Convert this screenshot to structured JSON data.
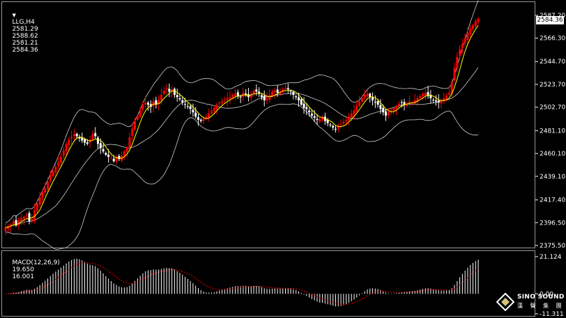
{
  "header": {
    "symbol": "LLG,H4",
    "open": "2581.29",
    "high": "2588.62",
    "low": "2581.21",
    "close": "2584.36"
  },
  "macd_header": {
    "label": "MACD(12,26,9)",
    "main": "19.650",
    "signal": "16.001"
  },
  "price_axis": {
    "ticks": [
      "2587.20",
      "2566.30",
      "2544.70",
      "2523.70",
      "2502.70",
      "2481.10",
      "2460.10",
      "2439.10",
      "2417.40",
      "2396.50",
      "2375.50"
    ],
    "last_price": "2584.36"
  },
  "macd_axis": {
    "ticks": [
      "21.124",
      "0.00",
      "-11.311"
    ]
  },
  "logo": {
    "brand": "SINO SOUND",
    "sub": "漢 聲 集 團"
  },
  "colors": {
    "background": "#000000",
    "bull_candle": "#ffffff",
    "bear_candle": "#ff0000",
    "bands": "#ffffff",
    "ma_line": "#ffff00",
    "macd_hist": "#ffffff",
    "macd_signal": "#ff0000"
  },
  "chart_data": {
    "type": "candlestick",
    "timeframe": "H4",
    "ylim": [
      2375.5,
      2587.2
    ],
    "close_series": [
      2392,
      2393,
      2395,
      2398,
      2394,
      2399,
      2401,
      2402,
      2404,
      2398,
      2400,
      2408,
      2414,
      2420,
      2425,
      2428,
      2434,
      2440,
      2444,
      2448,
      2452,
      2457,
      2463,
      2469,
      2473,
      2475,
      2478,
      2476,
      2474,
      2472,
      2470,
      2469,
      2473,
      2478,
      2476,
      2469,
      2465,
      2462,
      2459,
      2457,
      2456,
      2453,
      2457,
      2455,
      2458,
      2462,
      2466,
      2475,
      2483,
      2490,
      2495,
      2500,
      2505,
      2507,
      2505,
      2503,
      2508,
      2505,
      2509,
      2514,
      2518,
      2520,
      2517,
      2519,
      2514,
      2512,
      2510,
      2507,
      2505,
      2503,
      2501,
      2498,
      2494,
      2491,
      2490,
      2492,
      2494,
      2497,
      2499,
      2502,
      2505,
      2507,
      2508,
      2509,
      2511,
      2512,
      2514,
      2515,
      2513,
      2512,
      2516,
      2514,
      2512,
      2515,
      2518,
      2517,
      2515,
      2512,
      2509,
      2511,
      2514,
      2517,
      2518,
      2516,
      2517,
      2519,
      2520,
      2519,
      2517,
      2514,
      2512,
      2509,
      2505,
      2502,
      2501,
      2498,
      2495,
      2493,
      2491,
      2492,
      2494,
      2490,
      2488,
      2486,
      2484,
      2482,
      2485,
      2487,
      2489,
      2491,
      2494,
      2497,
      2500,
      2504,
      2508,
      2511,
      2514,
      2515,
      2512,
      2509,
      2507,
      2505,
      2501,
      2498,
      2495,
      2498,
      2500,
      2502,
      2504,
      2506,
      2507,
      2505,
      2506,
      2508,
      2507,
      2509,
      2511,
      2513,
      2515,
      2516,
      2513,
      2511,
      2509,
      2508,
      2507,
      2509,
      2511,
      2513,
      2516,
      2526,
      2539,
      2549,
      2556,
      2561,
      2566,
      2571,
      2575,
      2578,
      2582,
      2584
    ],
    "macd": {
      "main_current": 19.65,
      "signal_current": 16.001,
      "ylim": [
        -11.311,
        21.124
      ]
    }
  }
}
